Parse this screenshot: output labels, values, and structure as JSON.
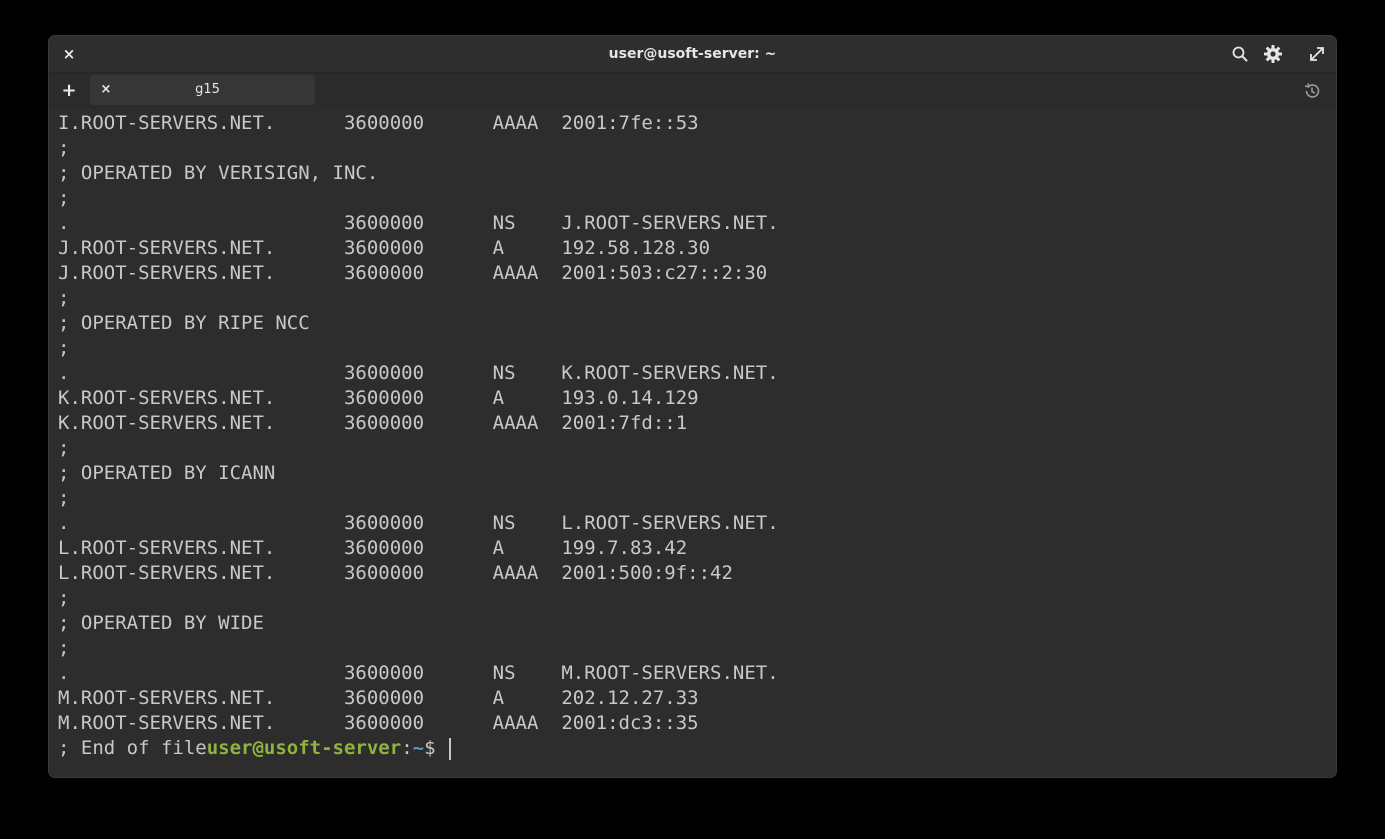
{
  "window": {
    "title": "user@usoft-server: ~",
    "close_glyph": "×"
  },
  "tabs": {
    "add_glyph": "+",
    "items": [
      {
        "label": "g15",
        "close_glyph": "×"
      }
    ]
  },
  "terminal": {
    "lines": [
      "I.ROOT-SERVERS.NET.      3600000      AAAA  2001:7fe::53",
      ";",
      "; OPERATED BY VERISIGN, INC.",
      ";",
      ".                        3600000      NS    J.ROOT-SERVERS.NET.",
      "J.ROOT-SERVERS.NET.      3600000      A     192.58.128.30",
      "J.ROOT-SERVERS.NET.      3600000      AAAA  2001:503:c27::2:30",
      ";",
      "; OPERATED BY RIPE NCC",
      ";",
      ".                        3600000      NS    K.ROOT-SERVERS.NET.",
      "K.ROOT-SERVERS.NET.      3600000      A     193.0.14.129",
      "K.ROOT-SERVERS.NET.      3600000      AAAA  2001:7fd::1",
      ";",
      "; OPERATED BY ICANN",
      ";",
      ".                        3600000      NS    L.ROOT-SERVERS.NET.",
      "L.ROOT-SERVERS.NET.      3600000      A     199.7.83.42",
      "L.ROOT-SERVERS.NET.      3600000      AAAA  2001:500:9f::42",
      ";",
      "; OPERATED BY WIDE",
      ";",
      ".                        3600000      NS    M.ROOT-SERVERS.NET.",
      "M.ROOT-SERVERS.NET.      3600000      A     202.12.27.33",
      "M.ROOT-SERVERS.NET.      3600000      AAAA  2001:dc3::35"
    ],
    "last_output": "; End of file",
    "prompt": {
      "user_host": "user@usoft-server",
      "colon": ":",
      "path": "~",
      "symbol": "$ "
    }
  },
  "colors": {
    "background": "#2d2d2d",
    "text": "#c8c8c8",
    "prompt_user": "#8fb33d",
    "prompt_path": "#4d9bd6"
  },
  "icons": {
    "close": "close-icon",
    "search": "search-icon",
    "settings": "gear-icon",
    "fullscreen": "fullscreen-icon",
    "add_tab": "plus-icon",
    "history": "history-icon"
  }
}
